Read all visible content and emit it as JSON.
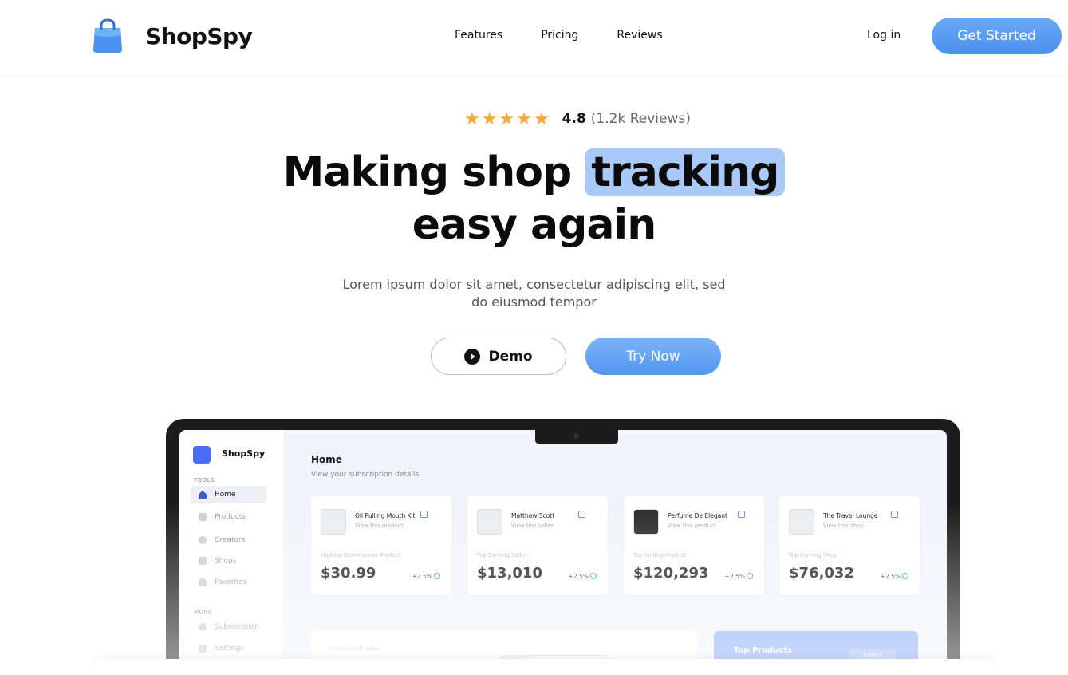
{
  "header": {
    "brand": "ShopSpy",
    "nav": [
      "Features",
      "Pricing",
      "Reviews"
    ],
    "login": "Log in",
    "cta": "Get Started"
  },
  "hero": {
    "stars": 5,
    "rating": "4.8",
    "reviews": "(1.2k Reviews)",
    "headline_part1": "Making shop ",
    "headline_highlight": "tracking",
    "headline_line2": "easy again",
    "subtitle_line1": "Lorem ipsum dolor sit amet, consectetur adipiscing elit, sed",
    "subtitle_line2": "do eiusmod tempor",
    "demo_label": "Demo",
    "try_label": "Try Now"
  },
  "dashboard": {
    "brand": "ShopSpy",
    "sections": {
      "tools": "TOOLS",
      "more": "MORE"
    },
    "tools": [
      "Home",
      "Products",
      "Creators",
      "Shops",
      "Favorites"
    ],
    "more": [
      "Subscription",
      "Settings"
    ],
    "page_title": "Home",
    "page_subtitle": "View your subscription details",
    "cards": [
      {
        "name": "Oil Pulling Mouth Kit",
        "link": "View this product",
        "metric": "Highest Commission Product",
        "value": "$30.99",
        "change": "+2.5%"
      },
      {
        "name": "Matthew Scott",
        "link": "View this seller",
        "metric": "Top Earning Seller",
        "value": "$13,010",
        "change": "+2.5%"
      },
      {
        "name": "Perfume De Elegant",
        "link": "View this product",
        "metric": "Top Selling Product",
        "value": "$120,293",
        "change": "+2.5%"
      },
      {
        "name": "The Travel Lounge",
        "link": "View this shop",
        "metric": "Top Earning Shop",
        "value": "$76,032",
        "change": "+2.5%"
      }
    ],
    "commission_label": "Commission Value",
    "top_products": "Top Products",
    "export": "Export"
  },
  "colors": {
    "accent": "#5b9cf3",
    "highlight": "#a9c9f8",
    "star": "#f7a93a",
    "sidebar_active_icon": "#3a5bd9"
  }
}
